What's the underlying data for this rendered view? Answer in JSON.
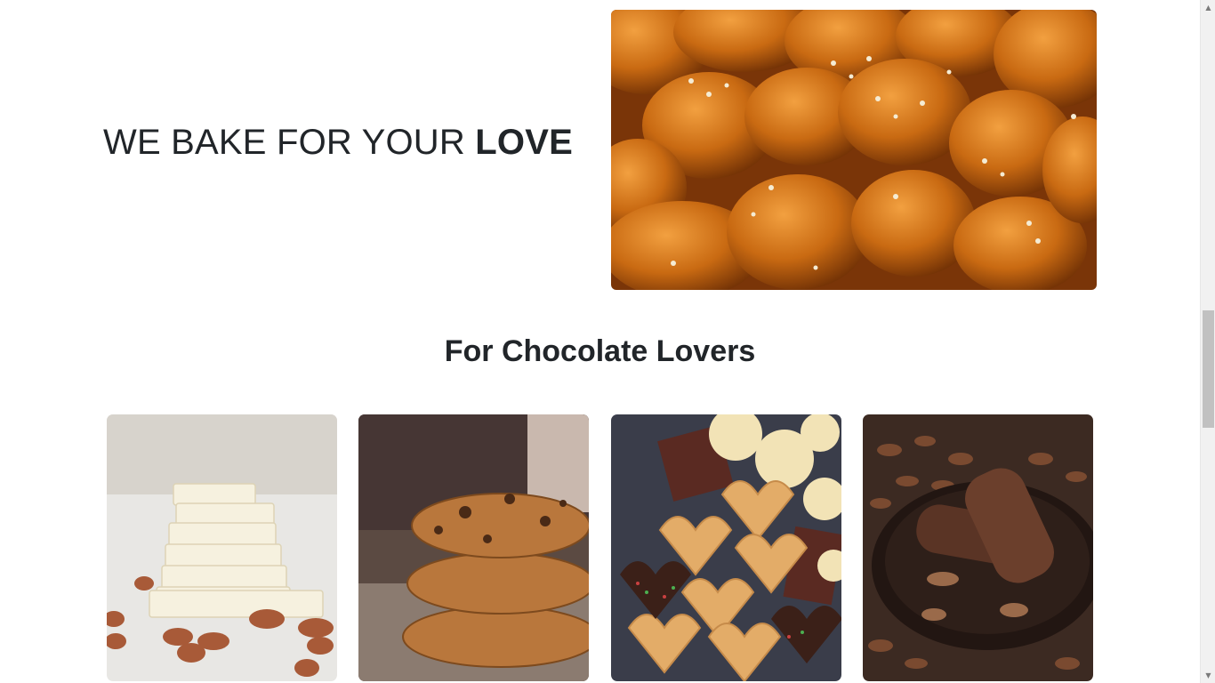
{
  "hero": {
    "heading_regular": "WE BAKE FOR YOUR ",
    "heading_bold": "LOVE",
    "image_icon": "bread-rolls-photo"
  },
  "section": {
    "title": "For Chocolate Lovers"
  },
  "cards": [
    {
      "icon": "white-chocolate-almonds-photo"
    },
    {
      "icon": "chocolate-chip-cookies-photo"
    },
    {
      "icon": "assorted-cookies-photo"
    },
    {
      "icon": "chocolate-ice-cream-bars-photo"
    }
  ],
  "scrollbar": {
    "up_icon": "scroll-up-arrow-icon",
    "down_icon": "scroll-down-arrow-icon"
  },
  "colors": {
    "text": "#212529",
    "background": "#ffffff",
    "scrollbar_track": "#f1f1f1",
    "scrollbar_thumb": "#c1c1c1"
  }
}
